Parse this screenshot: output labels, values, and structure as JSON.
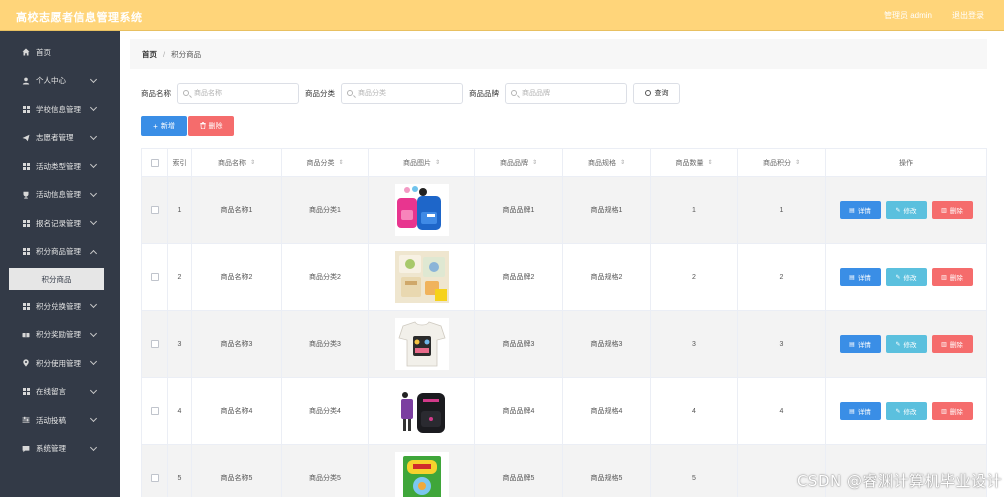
{
  "header": {
    "app_title": "高校志愿者信息管理系统",
    "user_label": "管理员 admin",
    "logout_label": "退出登录"
  },
  "sidebar": {
    "items": [
      {
        "label": "首页",
        "icon": "home-icon",
        "has_children": false
      },
      {
        "label": "个人中心",
        "icon": "user-icon",
        "has_children": true
      },
      {
        "label": "学校信息管理",
        "icon": "grid-icon",
        "has_children": true
      },
      {
        "label": "志愿者管理",
        "icon": "send-icon",
        "has_children": true
      },
      {
        "label": "活动类型管理",
        "icon": "grid-icon",
        "has_children": true
      },
      {
        "label": "活动信息管理",
        "icon": "trophy-icon",
        "has_children": true
      },
      {
        "label": "报名记录管理",
        "icon": "grid-icon",
        "has_children": true
      },
      {
        "label": "积分商品管理",
        "icon": "grid-icon",
        "has_children": true
      }
    ],
    "active_sub": "积分商品",
    "items_after": [
      {
        "label": "积分兑换管理",
        "icon": "grid-icon"
      },
      {
        "label": "积分奖励管理",
        "icon": "ticket-icon"
      },
      {
        "label": "积分使用管理",
        "icon": "location-icon"
      },
      {
        "label": "在线留言",
        "icon": "grid-icon"
      },
      {
        "label": "活动投稿",
        "icon": "sliders-icon"
      },
      {
        "label": "系统管理",
        "icon": "chat-icon"
      }
    ]
  },
  "breadcrumb": {
    "home": "首页",
    "separator": "/",
    "current": "积分商品"
  },
  "search": {
    "name_label": "商品名称",
    "name_placeholder": "商品名称",
    "category_label": "商品分类",
    "category_placeholder": "商品分类",
    "brand_label": "商品品牌",
    "brand_placeholder": "商品品牌",
    "query_label": "查询"
  },
  "actions": {
    "add_label": "新增",
    "delete_label": "删除"
  },
  "table": {
    "headers": [
      "索引",
      "商品名称",
      "商品分类",
      "商品图片",
      "商品品牌",
      "商品规格",
      "商品数量",
      "商品积分",
      "操作"
    ],
    "sort_glyph": "⇕",
    "rows": [
      {
        "index": "1",
        "name": "商品名称1",
        "category": "商品分类1",
        "brand": "商品品牌1",
        "spec": "商品规格1",
        "qty": "1",
        "points": "1"
      },
      {
        "index": "2",
        "name": "商品名称2",
        "category": "商品分类2",
        "brand": "商品品牌2",
        "spec": "商品规格2",
        "qty": "2",
        "points": "2"
      },
      {
        "index": "3",
        "name": "商品名称3",
        "category": "商品分类3",
        "brand": "商品品牌3",
        "spec": "商品规格3",
        "qty": "3",
        "points": "3"
      },
      {
        "index": "4",
        "name": "商品名称4",
        "category": "商品分类4",
        "brand": "商品品牌4",
        "spec": "商品规格4",
        "qty": "4",
        "points": "4"
      },
      {
        "index": "5",
        "name": "商品名称5",
        "category": "商品分类5",
        "brand": "商品品牌5",
        "spec": "商品规格5",
        "qty": "5",
        "points": ""
      }
    ],
    "op_labels": {
      "detail": "详情",
      "edit": "修改",
      "delete": "删除"
    }
  },
  "watermark": "CSDN @睿渊计算机毕业设计",
  "colors": {
    "header_bg": "#ffd57a",
    "sidebar_bg": "#333a47",
    "primary": "#3a8ee6",
    "info": "#5bc0de",
    "danger": "#f56c6c"
  }
}
